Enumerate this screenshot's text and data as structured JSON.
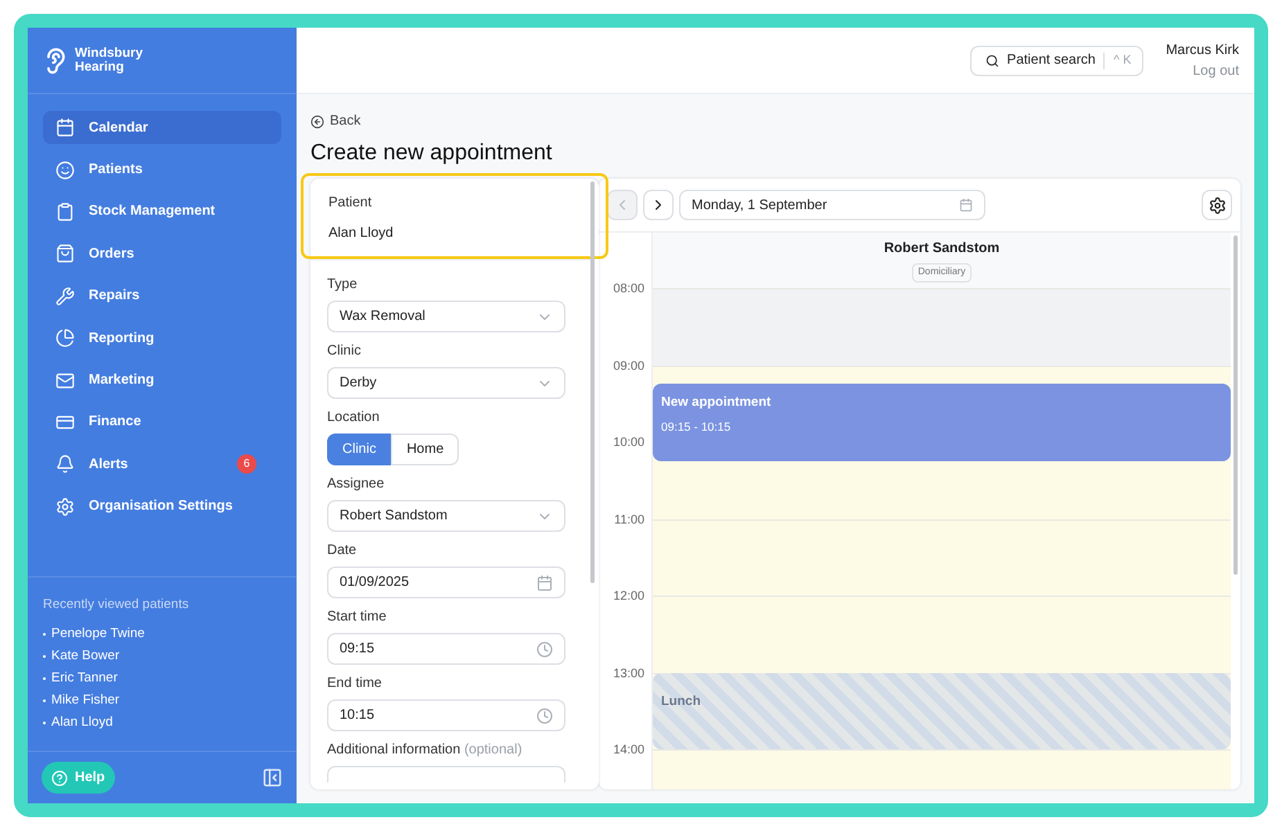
{
  "brand": {
    "name": "Windsbury Hearing"
  },
  "nav": [
    {
      "label": "Calendar",
      "selected": true
    },
    {
      "label": "Patients",
      "selected": false
    },
    {
      "label": "Stock Management",
      "selected": false
    },
    {
      "label": "Orders",
      "selected": false
    },
    {
      "label": "Repairs",
      "selected": false
    },
    {
      "label": "Reporting",
      "selected": false
    },
    {
      "label": "Marketing",
      "selected": false
    },
    {
      "label": "Finance",
      "selected": false
    },
    {
      "label": "Alerts",
      "selected": false,
      "badge": "6"
    },
    {
      "label": "Organisation Settings",
      "selected": false
    }
  ],
  "recent": {
    "title": "Recently viewed patients",
    "items": [
      "Penelope Twine",
      "Kate Bower",
      "Eric Tanner",
      "Mike Fisher",
      "Alan Lloyd"
    ]
  },
  "help": {
    "label": "Help"
  },
  "header": {
    "search": {
      "label": "Patient search",
      "shortcut": "^ K"
    },
    "user": {
      "name": "Marcus Kirk",
      "logout": "Log out"
    }
  },
  "page": {
    "back": "Back",
    "title": "Create new appointment"
  },
  "form": {
    "patient": {
      "label": "Patient",
      "value": "Alan Lloyd",
      "highlighted": true
    },
    "fields": [
      {
        "kind": "select",
        "label": "Type",
        "value": "Wax Removal"
      },
      {
        "kind": "select",
        "label": "Clinic",
        "value": "Derby"
      },
      {
        "kind": "toggle",
        "label": "Location",
        "options": [
          {
            "label": "Clinic",
            "selected": true
          },
          {
            "label": "Home",
            "selected": false
          }
        ]
      },
      {
        "kind": "select",
        "label": "Assignee",
        "value": "Robert Sandstom"
      },
      {
        "kind": "date",
        "label": "Date",
        "value": "01/09/2025"
      },
      {
        "kind": "time",
        "label": "Start time",
        "value": "09:15"
      },
      {
        "kind": "time",
        "label": "End time",
        "value": "10:15"
      },
      {
        "kind": "textarea",
        "label": "Additional information",
        "hint": "(optional)"
      }
    ]
  },
  "calendar": {
    "prev": {
      "disabled": true
    },
    "next": {
      "disabled": false
    },
    "date": "Monday, 1 September",
    "column": {
      "name": "Robert Sandstom",
      "tag": "Domiciliary"
    },
    "hours": [
      "08:00",
      "09:00",
      "10:00",
      "11:00",
      "12:00",
      "13:00",
      "14:00"
    ],
    "events": [
      {
        "kind": "unavailable"
      },
      {
        "kind": "appointment",
        "title": "New appointment",
        "time": "09:15 - 10:15"
      },
      {
        "kind": "break",
        "title": "Lunch"
      }
    ]
  }
}
